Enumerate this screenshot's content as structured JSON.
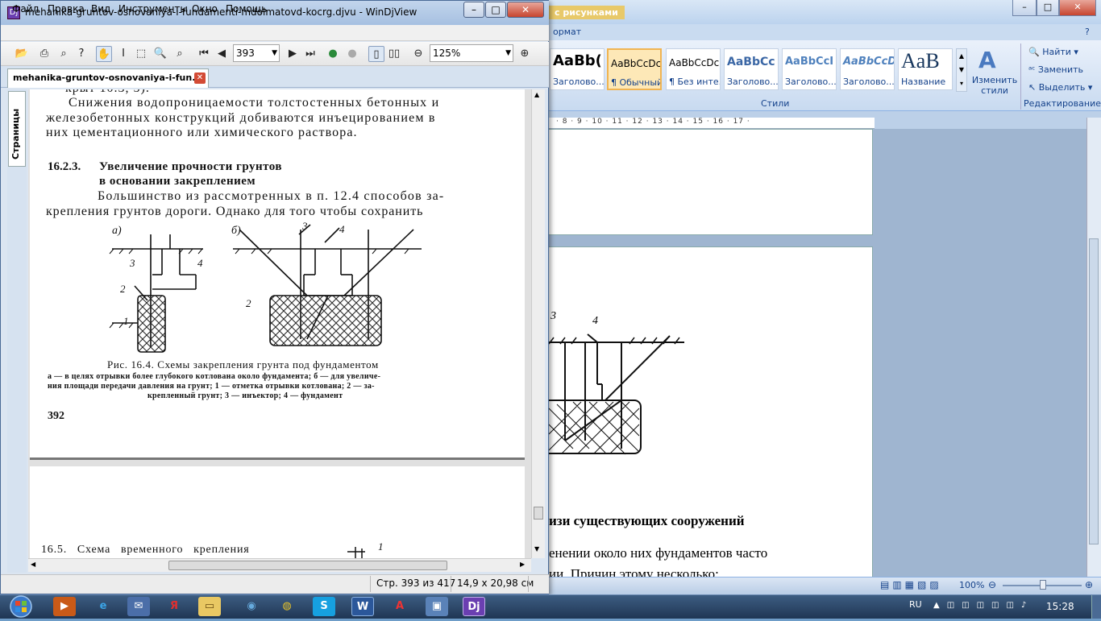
{
  "djvu": {
    "title": "mehanika-gruntov-osnovaniya-i-fundamenti-mdolmatovd-kocrg.djvu - WinDjView",
    "menu": [
      "Файл",
      "Правка",
      "Вид",
      "Инструменты",
      "Окно",
      "Помощь"
    ],
    "page_combo": "393",
    "zoom_combo": "125%",
    "tab_label": "mehanika-gruntov-osnovaniya-i-fun...",
    "side_tab": "Страницы",
    "status_page": "Стр. 393 из 417",
    "status_size": "14,9 x 20,98 см",
    "page1": {
      "para1_l1": "Снижения водопроницаемости толстостенных бетонных и",
      "para1_l2": "железобетонных конструкций добиваются инъецированием в",
      "para1_l3": "них цементационного или химического раствора.",
      "heading_num": "16.2.3.",
      "heading_l1": "Увеличение прочности грунтов",
      "heading_l2": "в основании закреплением",
      "para2_l1": "Большинство из рассмотренных в п. 12.4 способов за-",
      "para2_l2": "крепления грунтов дороги. Однако для того чтобы сохранить",
      "fig_a": "а)",
      "fig_b": "б)",
      "lbl_1": "1",
      "lbl_2": "2",
      "lbl_3": "3",
      "lbl_4": "4",
      "caption": "Рис. 16.4. Схемы закрепления грунта под фундаментом",
      "legend_l1": "а — в целях отрывки более глубокого котлована около фундамента; б — для увеличе-",
      "legend_l2": "ния площади передачи давления на грунт; 1 — отметка отрывки котлована; 2 — за-",
      "legend_l3": "крепленный грунт; 3 — инъектор; 4 — фундамент",
      "page_num": "392"
    },
    "page2": {
      "heading": "16.5.   Схема   временного   крепления",
      "fig_label": "1"
    }
  },
  "word": {
    "context_tab": "с рисунками",
    "format_tab": "ормат",
    "styles": [
      {
        "preview": "AaBb(",
        "name": "Заголово..."
      },
      {
        "preview": "AaBbCcDc",
        "name": "¶ Обычный"
      },
      {
        "preview": "AaBbCcDc",
        "name": "¶ Без инте..."
      },
      {
        "preview": "AaBbCc",
        "name": "Заголово..."
      },
      {
        "preview": "AaBbCcI",
        "name": "Заголово..."
      },
      {
        "preview": "AaBbCcD",
        "name": "Заголово..."
      },
      {
        "preview": "AaB",
        "name": "Название"
      }
    ],
    "change_styles": "Изменить стили",
    "styles_group": "Стили",
    "find": "Найти",
    "replace": "Заменить",
    "select": "Выделить",
    "edit_group": "Редактирование",
    "ruler": "· 8 · 9 · 10 · 11 · 12 · 13 · 14 · 15 · 16 · 17 ·",
    "fig_3": "3",
    "fig_4": "4",
    "doc_heading": "изи существующих сооружений",
    "doc_line1": "енении около них фундаментов часто",
    "doc_line2": "ии. Причин этому несколько:",
    "zoom": "100%"
  },
  "taskbar": {
    "lang": "RU",
    "time": "15:28"
  }
}
